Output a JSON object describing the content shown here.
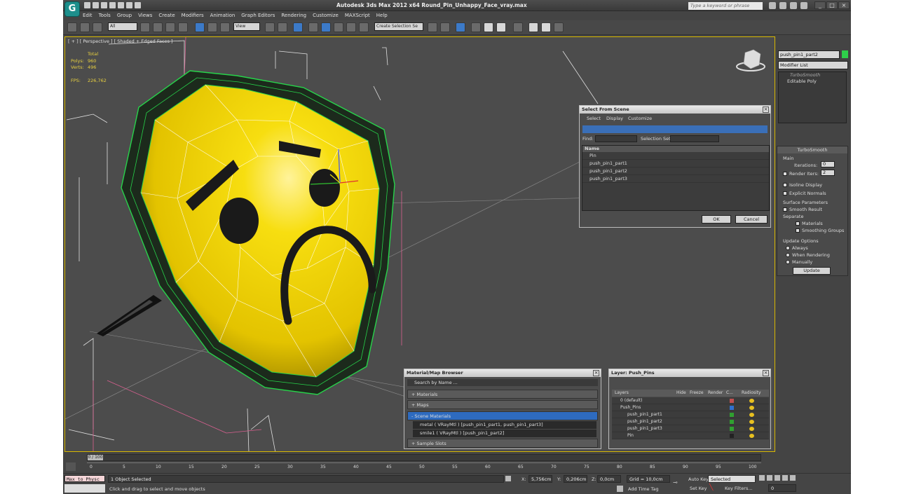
{
  "app": {
    "title": "Autodesk 3ds Max  2012 x64     Round_Pin_Unhappy_Face_vray.max",
    "search_placeholder": "Type a keyword or phrase",
    "logo_glyph": "G"
  },
  "menu": [
    "Edit",
    "Tools",
    "Group",
    "Views",
    "Create",
    "Modifiers",
    "Animation",
    "Graph Editors",
    "Rendering",
    "Customize",
    "MAXScript",
    "Help"
  ],
  "toolbar": {
    "filter": "All",
    "view": "View",
    "selection_set": "Create Selection Se"
  },
  "viewport": {
    "label": "[ + ] [ Perspective ] [ Shaded + Edged Faces ]",
    "stats": {
      "total": "Total",
      "polys_label": "Polys:",
      "polys": "960",
      "verts_label": "Verts:",
      "verts": "496",
      "fps_label": "FPS:",
      "fps": "226,762"
    }
  },
  "command_panel": {
    "object_name": "push_pin1_part2",
    "modifier_list": "Modifier List",
    "stack": [
      "TurboSmooth",
      "Editable Poly"
    ],
    "turbosmooth": {
      "title": "TurboSmooth",
      "main": "Main",
      "iterations_label": "Iterations:",
      "iterations": "0",
      "render_iters_label": "Render Iters:",
      "render_iters": "2",
      "isoline": "Isoline Display",
      "explicit": "Explicit Normals",
      "surface": "Surface Parameters",
      "smooth_result": "Smooth Result",
      "separate": "Separate",
      "materials": "Materials",
      "smoothing_groups": "Smoothing Groups",
      "update_options": "Update Options",
      "always": "Always",
      "when_rendering": "When Rendering",
      "manually": "Manually",
      "update": "Update"
    }
  },
  "select_dialog": {
    "title": "Select From Scene",
    "menu": [
      "Select",
      "Display",
      "Customize"
    ],
    "find_label": "Find:",
    "selset_label": "Selection Set:",
    "column": "Name",
    "items": [
      "Pin",
      "push_pin1_part1",
      "push_pin1_part2",
      "push_pin1_part3"
    ],
    "ok": "OK",
    "cancel": "Cancel"
  },
  "material_browser": {
    "title": "Material/Map Browser",
    "search": "Search by Name ...",
    "materials": "+ Materials",
    "maps": "+ Maps",
    "scene_materials": "- Scene Materials",
    "mat1": "metal  ( VRayMtl )  [push_pin1_part1, push_pin1_part3]",
    "mat2": "smile1  ( VRayMtl )  [push_pin1_part2]",
    "sample_slots": "+ Sample Slots"
  },
  "layer_dialog": {
    "title": "Layer: Push_Pins",
    "columns": [
      "Layers",
      "Hide",
      "Freeze",
      "Render",
      "C...",
      "Radiosity"
    ],
    "rows": [
      "0 (default)",
      "Push_Pins",
      "push_pin1_part1",
      "push_pin1_part2",
      "push_pin1_part3",
      "Pin"
    ],
    "colors": [
      "#c05050",
      "#3070d0",
      "#30a030",
      "#30a030",
      "#30a030",
      "#222222"
    ]
  },
  "timeline": {
    "frame": "0 / 100",
    "ticks": [
      "0",
      "5",
      "10",
      "15",
      "20",
      "25",
      "30",
      "35",
      "40",
      "45",
      "50",
      "55",
      "60",
      "65",
      "70",
      "75",
      "80",
      "85",
      "90",
      "95",
      "100"
    ]
  },
  "status": {
    "maxscript": "Max to Physc",
    "objects": "1 Object Selected",
    "prompt": "Click and drag to select and move objects",
    "x_label": "X:",
    "x": "5,756cm",
    "y_label": "Y:",
    "y": "0,206cm",
    "z_label": "Z:",
    "z": "0,0cm",
    "grid": "Grid = 10,0cm",
    "add_time_tag": "Add Time Tag",
    "auto_key": "Auto Key",
    "set_key": "Set Key",
    "key_mode": "Selected",
    "key_filters": "Key Filters...",
    "frame_field": "0"
  }
}
